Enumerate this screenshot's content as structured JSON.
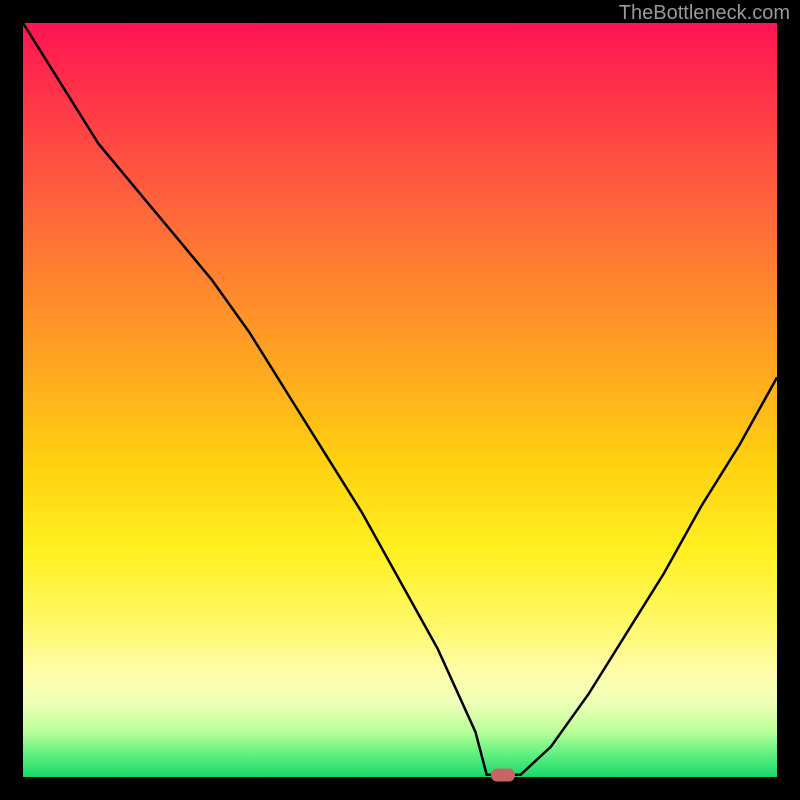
{
  "watermark": "TheBottleneck.com",
  "chart_data": {
    "type": "line",
    "title": "",
    "xlabel": "",
    "ylabel": "",
    "x": [
      0,
      0.05,
      0.1,
      0.15,
      0.2,
      0.25,
      0.3,
      0.35,
      0.4,
      0.45,
      0.5,
      0.55,
      0.6,
      0.615,
      0.63,
      0.66,
      0.7,
      0.75,
      0.8,
      0.85,
      0.9,
      0.95,
      1.0
    ],
    "values": [
      1.0,
      0.92,
      0.84,
      0.78,
      0.72,
      0.66,
      0.59,
      0.51,
      0.43,
      0.35,
      0.26,
      0.17,
      0.06,
      0.003,
      0.003,
      0.003,
      0.04,
      0.11,
      0.19,
      0.27,
      0.36,
      0.44,
      0.53
    ],
    "marker": {
      "x": 0.636,
      "y": 0.003
    },
    "xlim": [
      0,
      1
    ],
    "ylim": [
      0,
      1
    ]
  }
}
